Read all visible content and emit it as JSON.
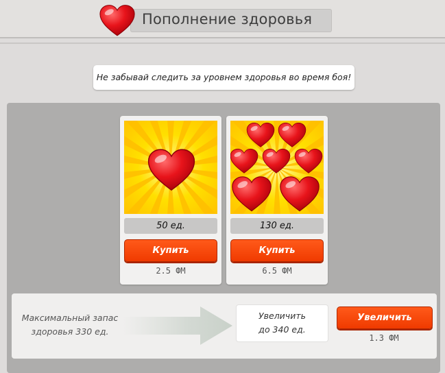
{
  "header": {
    "title": "Пополнение здоровья",
    "icon": "heart-icon"
  },
  "hint": "Не забывай следить за уровнем здоровья во время боя!",
  "packs": [
    {
      "amount": "50 ед.",
      "buy_label": "Купить",
      "price": "2.5 ФМ",
      "icon": "single-heart-icon"
    },
    {
      "amount": "130 ед.",
      "buy_label": "Купить",
      "price": "6.5 ФМ",
      "icon": "many-hearts-icon"
    }
  ],
  "upgrade": {
    "current_line1": "Максимальный запас",
    "current_line2": "здоровья 330 ед.",
    "target_line1": "Увеличить",
    "target_line2": "до 340 ед.",
    "button_label": "Увеличить",
    "price": "1.3 ФМ"
  },
  "colors": {
    "accent_button": "#f03a00",
    "card_bg": "#ffd000",
    "heart": "#e8141b"
  }
}
